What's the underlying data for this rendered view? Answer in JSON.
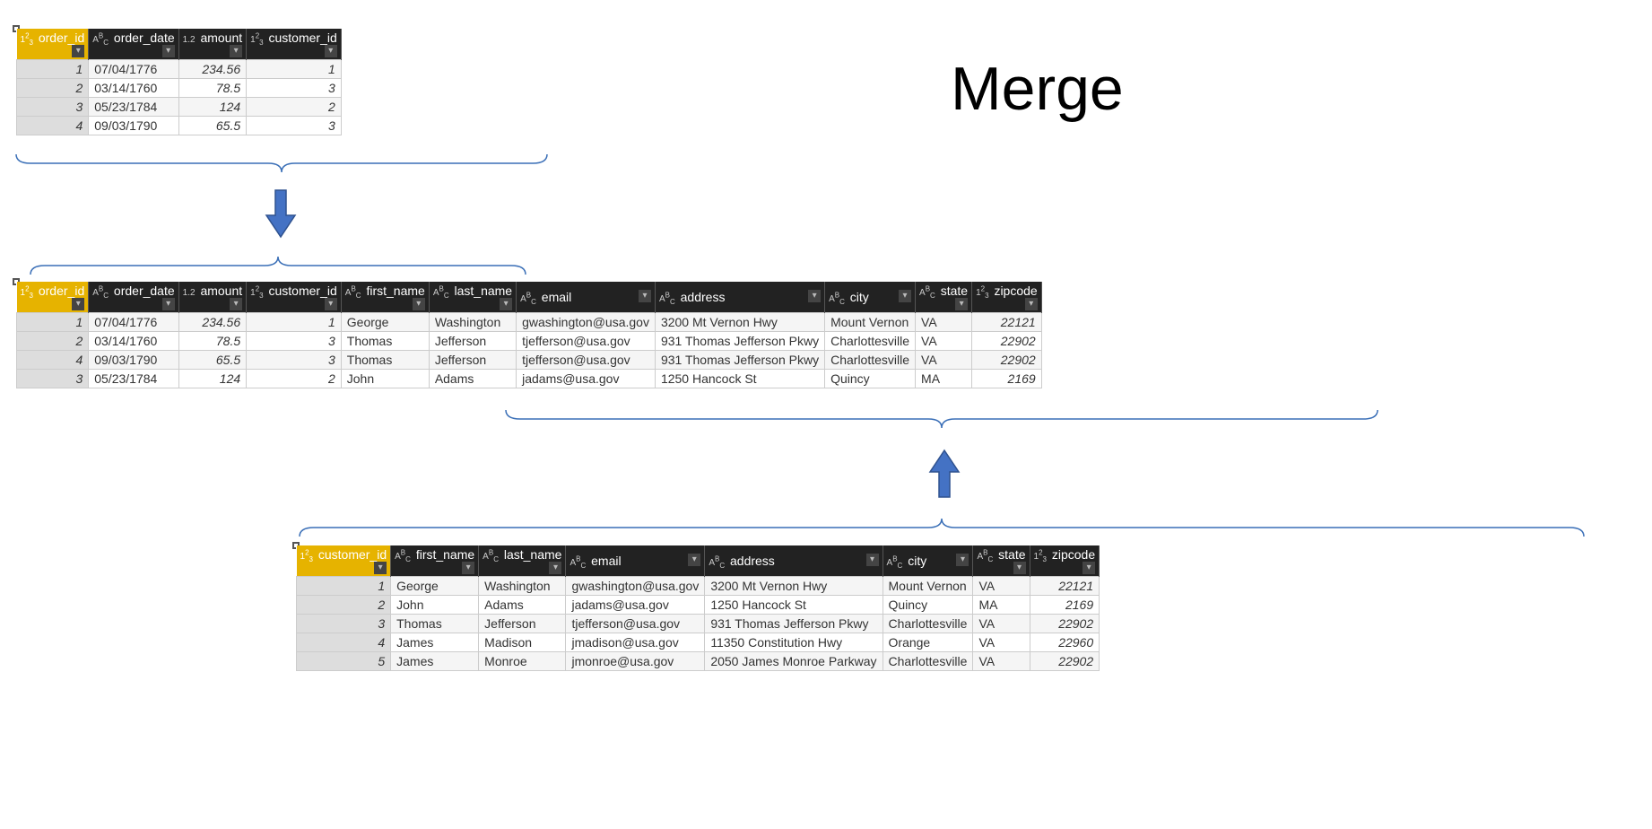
{
  "title": "Merge",
  "type_int": "1²₃",
  "type_text": "Aᴮc",
  "type_dec": "1.2",
  "orders": {
    "key": "order_id",
    "columns": [
      {
        "name": "order_id",
        "type": "int",
        "sel": true
      },
      {
        "name": "order_date",
        "type": "text"
      },
      {
        "name": "amount",
        "type": "dec"
      },
      {
        "name": "customer_id",
        "type": "int"
      }
    ],
    "rows": [
      {
        "idx": "1",
        "order_date": "07/04/1776",
        "amount": "234.56",
        "customer_id": "1"
      },
      {
        "idx": "2",
        "order_date": "03/14/1760",
        "amount": "78.5",
        "customer_id": "3"
      },
      {
        "idx": "3",
        "order_date": "05/23/1784",
        "amount": "124",
        "customer_id": "2"
      },
      {
        "idx": "4",
        "order_date": "09/03/1790",
        "amount": "65.5",
        "customer_id": "3"
      }
    ]
  },
  "merged": {
    "key": "order_id",
    "columns": [
      {
        "name": "order_id",
        "type": "int",
        "sel": true
      },
      {
        "name": "order_date",
        "type": "text"
      },
      {
        "name": "amount",
        "type": "dec"
      },
      {
        "name": "customer_id",
        "type": "int"
      },
      {
        "name": "first_name",
        "type": "text"
      },
      {
        "name": "last_name",
        "type": "text"
      },
      {
        "name": "email",
        "type": "text"
      },
      {
        "name": "address",
        "type": "text"
      },
      {
        "name": "city",
        "type": "text"
      },
      {
        "name": "state",
        "type": "text"
      },
      {
        "name": "zipcode",
        "type": "int"
      }
    ],
    "rows": [
      {
        "idx": "1",
        "order_date": "07/04/1776",
        "amount": "234.56",
        "customer_id": "1",
        "first_name": "George",
        "last_name": "Washington",
        "email": "gwashington@usa.gov",
        "address": "3200 Mt Vernon Hwy",
        "city": "Mount Vernon",
        "state": "VA",
        "zipcode": "22121"
      },
      {
        "idx": "2",
        "order_date": "03/14/1760",
        "amount": "78.5",
        "customer_id": "3",
        "first_name": "Thomas",
        "last_name": "Jefferson",
        "email": "tjefferson@usa.gov",
        "address": "931 Thomas Jefferson Pkwy",
        "city": "Charlottesville",
        "state": "VA",
        "zipcode": "22902"
      },
      {
        "idx": "4",
        "order_date": "09/03/1790",
        "amount": "65.5",
        "customer_id": "3",
        "first_name": "Thomas",
        "last_name": "Jefferson",
        "email": "tjefferson@usa.gov",
        "address": "931 Thomas Jefferson Pkwy",
        "city": "Charlottesville",
        "state": "VA",
        "zipcode": "22902"
      },
      {
        "idx": "3",
        "order_date": "05/23/1784",
        "amount": "124",
        "customer_id": "2",
        "first_name": "John",
        "last_name": "Adams",
        "email": "jadams@usa.gov",
        "address": "1250 Hancock St",
        "city": "Quincy",
        "state": "MA",
        "zipcode": "2169"
      }
    ]
  },
  "customers": {
    "key": "customer_id",
    "columns": [
      {
        "name": "customer_id",
        "type": "int",
        "sel": true
      },
      {
        "name": "first_name",
        "type": "text"
      },
      {
        "name": "last_name",
        "type": "text"
      },
      {
        "name": "email",
        "type": "text"
      },
      {
        "name": "address",
        "type": "text"
      },
      {
        "name": "city",
        "type": "text"
      },
      {
        "name": "state",
        "type": "text"
      },
      {
        "name": "zipcode",
        "type": "int"
      }
    ],
    "rows": [
      {
        "idx": "1",
        "first_name": "George",
        "last_name": "Washington",
        "email": "gwashington@usa.gov",
        "address": "3200 Mt Vernon Hwy",
        "city": "Mount Vernon",
        "state": "VA",
        "zipcode": "22121"
      },
      {
        "idx": "2",
        "first_name": "John",
        "last_name": "Adams",
        "email": "jadams@usa.gov",
        "address": "1250 Hancock St",
        "city": "Quincy",
        "state": "MA",
        "zipcode": "2169"
      },
      {
        "idx": "3",
        "first_name": "Thomas",
        "last_name": "Jefferson",
        "email": "tjefferson@usa.gov",
        "address": "931 Thomas Jefferson Pkwy",
        "city": "Charlottesville",
        "state": "VA",
        "zipcode": "22902"
      },
      {
        "idx": "4",
        "first_name": "James",
        "last_name": "Madison",
        "email": "jmadison@usa.gov",
        "address": "11350 Constitution Hwy",
        "city": "Orange",
        "state": "VA",
        "zipcode": "22960"
      },
      {
        "idx": "5",
        "first_name": "James",
        "last_name": "Monroe",
        "email": "jmonroe@usa.gov",
        "address": "2050 James Monroe Parkway",
        "city": "Charlottesville",
        "state": "VA",
        "zipcode": "22902"
      }
    ]
  },
  "colWidths": {
    "order_id": 150,
    "order_date": 160,
    "amount": 130,
    "customer_id": 130,
    "first_name": 140,
    "last_name": 150,
    "email": 170,
    "address": 200,
    "city": 130,
    "state": 90,
    "zipcode": 110
  }
}
